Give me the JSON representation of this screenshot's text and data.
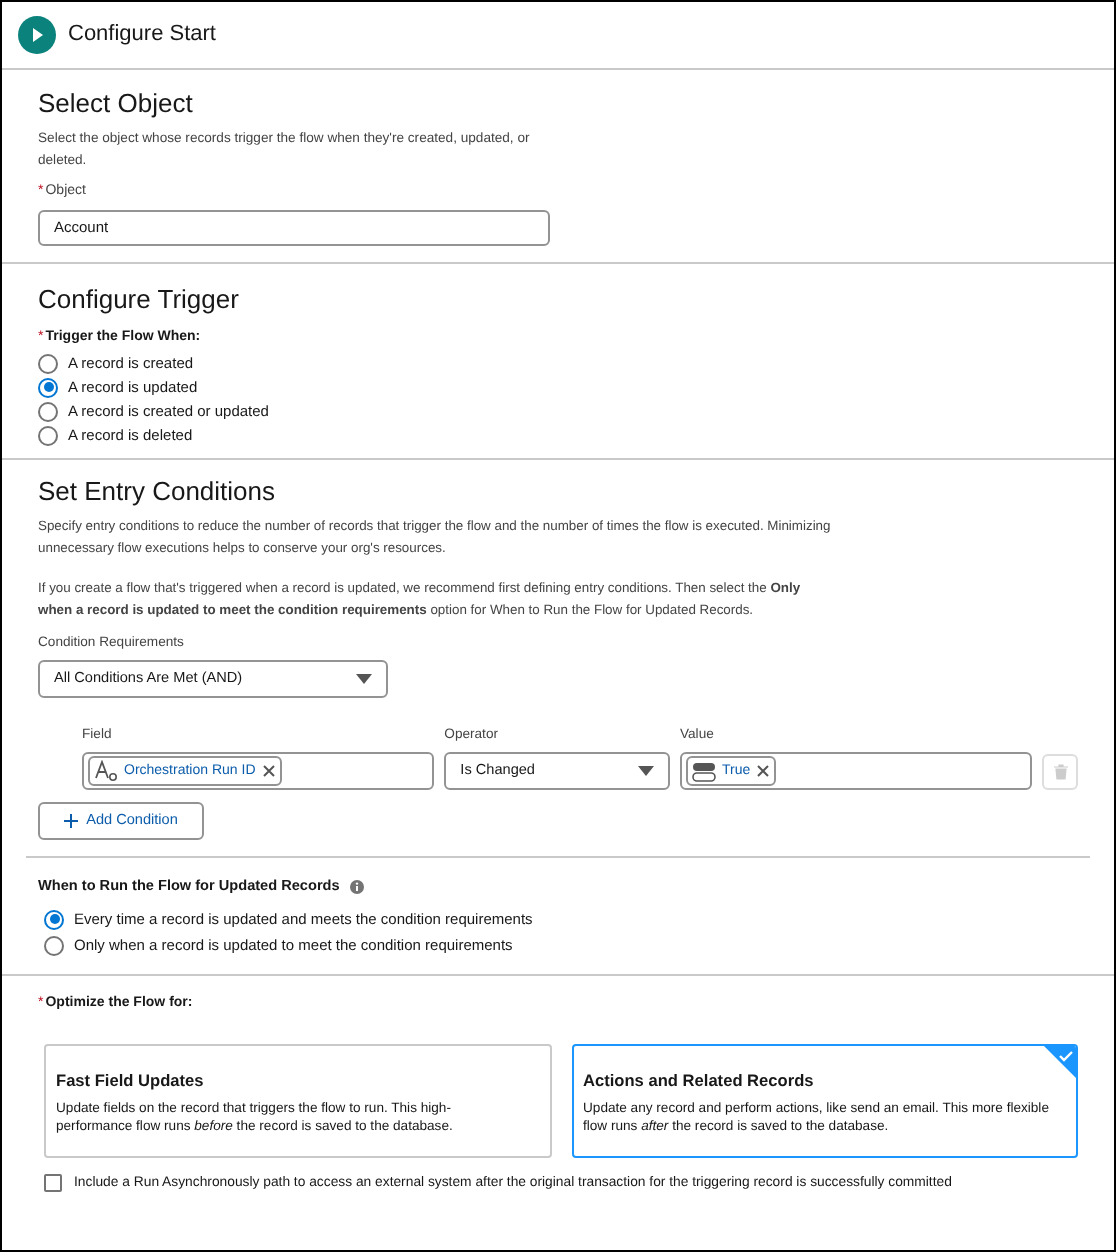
{
  "header": {
    "title": "Configure Start"
  },
  "select_object": {
    "title": "Select Object",
    "description": "Select the object whose records trigger the flow when they're created, updated, or deleted.",
    "object_field": {
      "required_mark": "*",
      "label": "Object",
      "value": "Account"
    }
  },
  "trigger": {
    "title": "Configure Trigger",
    "required_mark": "*",
    "label": "Trigger the Flow When:",
    "options": [
      {
        "label": "A record is created",
        "selected": false
      },
      {
        "label": "A record is updated",
        "selected": true
      },
      {
        "label": "A record is created or updated",
        "selected": false
      },
      {
        "label": "A record is deleted",
        "selected": false
      }
    ]
  },
  "entry_conditions": {
    "title": "Set Entry Conditions",
    "description": "Specify entry conditions to reduce the number of records that trigger the flow and the number of times the flow is executed. Minimizing unnecessary flow executions helps to conserve your org's resources.",
    "note": "If you create a flow that's triggered when a record is updated, we recommend first defining entry conditions. Then select the **Only when a record is updated to meet the condition requirements** option for When to Run the Flow for Updated Records.",
    "requirements": {
      "label": "Condition Requirements",
      "value": "All Conditions Are Met (AND)"
    },
    "columns": [
      "Field",
      "Operator",
      "Value"
    ],
    "condition": {
      "field": "Orchestration Run ID",
      "operator": "Is Changed",
      "value": "True"
    },
    "add_button": "Add Condition"
  },
  "when_to_run": {
    "title": "When to Run the Flow for Updated Records",
    "options": [
      {
        "label": "Every time a record is updated and meets the condition requirements",
        "selected": true
      },
      {
        "label": "Only when a record is updated to meet the condition requirements",
        "selected": false
      }
    ]
  },
  "optimize": {
    "required_mark": "*",
    "label": "Optimize the Flow for:",
    "cards": [
      {
        "title": "Fast Field Updates",
        "description": "Update fields on the record that triggers the flow to run. This high-performance flow runs *before* the record is saved to the database.",
        "selected": false
      },
      {
        "title": "Actions and Related Records",
        "description": "Update any record and perform actions, like send an email. This more flexible flow runs *after* the record is saved to the database.",
        "selected": true
      }
    ]
  },
  "async": {
    "label": "Include a Run Asynchronously path to access an external system after the original transaction for the triggering record is successfully committed",
    "checked": false
  }
}
